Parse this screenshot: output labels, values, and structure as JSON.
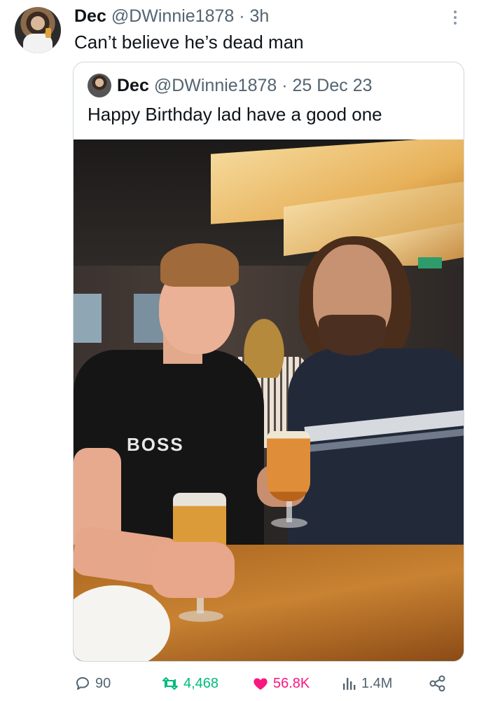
{
  "tweet": {
    "author_name": "Dec",
    "handle": "@DWinnie1878",
    "separator": "·",
    "time": "3h",
    "text": "Can’t believe he’s dead man"
  },
  "quote": {
    "author_name": "Dec",
    "handle": "@DWinnie1878",
    "separator": "·",
    "date": "25 Dec 23",
    "text": "Happy Birthday lad have a good one",
    "shirt_logo": "BOSS"
  },
  "actions": {
    "replies": "90",
    "retweets": "4,468",
    "likes": "56.8K",
    "views": "1.4M"
  },
  "icons": {
    "reply": "reply-icon",
    "retweet": "retweet-icon",
    "like": "heart-icon",
    "views": "views-icon",
    "share": "share-icon",
    "more": "more-icon"
  },
  "colors": {
    "retweet_active": "#00ba7c",
    "like_active": "#f91880",
    "muted": "#536471"
  }
}
